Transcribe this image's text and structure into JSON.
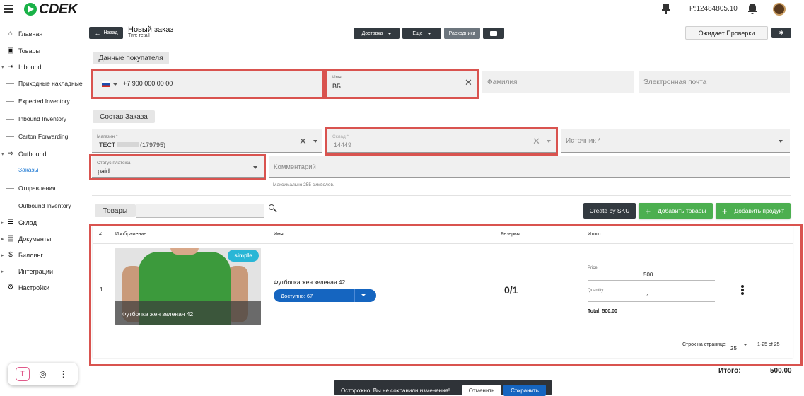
{
  "topbar": {
    "brand": "CDEK",
    "account_id": "P:12484805.10"
  },
  "sidebar": {
    "items": [
      {
        "label": "Главная",
        "icon": "home-icon"
      },
      {
        "label": "Товары",
        "icon": "box-icon"
      },
      {
        "label": "Inbound",
        "icon": "inbound-icon"
      },
      {
        "label": "Приходные накладные"
      },
      {
        "label": "Expected Inventory"
      },
      {
        "label": "Inbound Inventory"
      },
      {
        "label": "Carton Forwarding"
      },
      {
        "label": "Outbound",
        "icon": "outbound-icon"
      },
      {
        "label": "Заказы"
      },
      {
        "label": "Отправления"
      },
      {
        "label": "Outbound Inventory"
      },
      {
        "label": "Склад",
        "icon": "warehouse-icon"
      },
      {
        "label": "Документы",
        "icon": "document-icon"
      },
      {
        "label": "Биллинг",
        "icon": "dollar-icon"
      },
      {
        "label": "Интеграции",
        "icon": "grid-icon"
      },
      {
        "label": "Настройки",
        "icon": "gear-icon"
      }
    ],
    "active": "Заказы"
  },
  "header": {
    "back_label": "Назад",
    "title": "Новый заказ",
    "type_line": "Тип: retail",
    "delivery_label": "Доставка",
    "more_label": "Еще",
    "expenses_label": "Расходники",
    "status": "Ожидает Проверки"
  },
  "buyer": {
    "section_label": "Данные покупателя",
    "phone": "+7 900 000 00 00",
    "name_label": "Имя",
    "name_value": "ВБ",
    "surname_placeholder": "Фамилия",
    "email_placeholder": "Электронная почта"
  },
  "order": {
    "section_label": "Состав Заказа",
    "store_label": "Магазин *",
    "store_value": "ТЕСТ",
    "store_id": "(179795)",
    "warehouse_label": "Склад *",
    "warehouse_value": "14449",
    "source_placeholder": "Источник *",
    "payment_label": "Статус платежа",
    "payment_value": "paid",
    "comment_placeholder": "Комментарий",
    "comment_hint": "Максимально 255 символов."
  },
  "products": {
    "tab_label": "Товары",
    "create_sku": "Create by SKU",
    "add_goods": "Добавить товары",
    "add_product": "Добавить продукт",
    "columns": [
      "#",
      "Изображение",
      "Имя",
      "Резервы",
      "Итого"
    ],
    "rows": [
      {
        "index": "1",
        "badge": "simple",
        "image_caption": "Футболка жен зеленая 42",
        "name": "Футболка жен зеленая 42",
        "available": "Доступно: 67",
        "reserve": "0/1",
        "price_label": "Price",
        "price": "500",
        "qty_label": "Quantity",
        "qty": "1",
        "total": "Total: 500.00"
      }
    ],
    "rows_per_page_label": "Строк на странице",
    "rows_per_page": "25",
    "range": "1-25 of 25"
  },
  "summary": {
    "total_label": "Итого:",
    "total_value": "500.00"
  },
  "toast": {
    "message": "Осторожно! Вы не сохранили изменения!",
    "cancel": "Отменить",
    "save": "Сохранить"
  },
  "colors": {
    "accent_blue": "#1565c0",
    "green": "#4caf50",
    "highlight_red": "#d9534f"
  }
}
